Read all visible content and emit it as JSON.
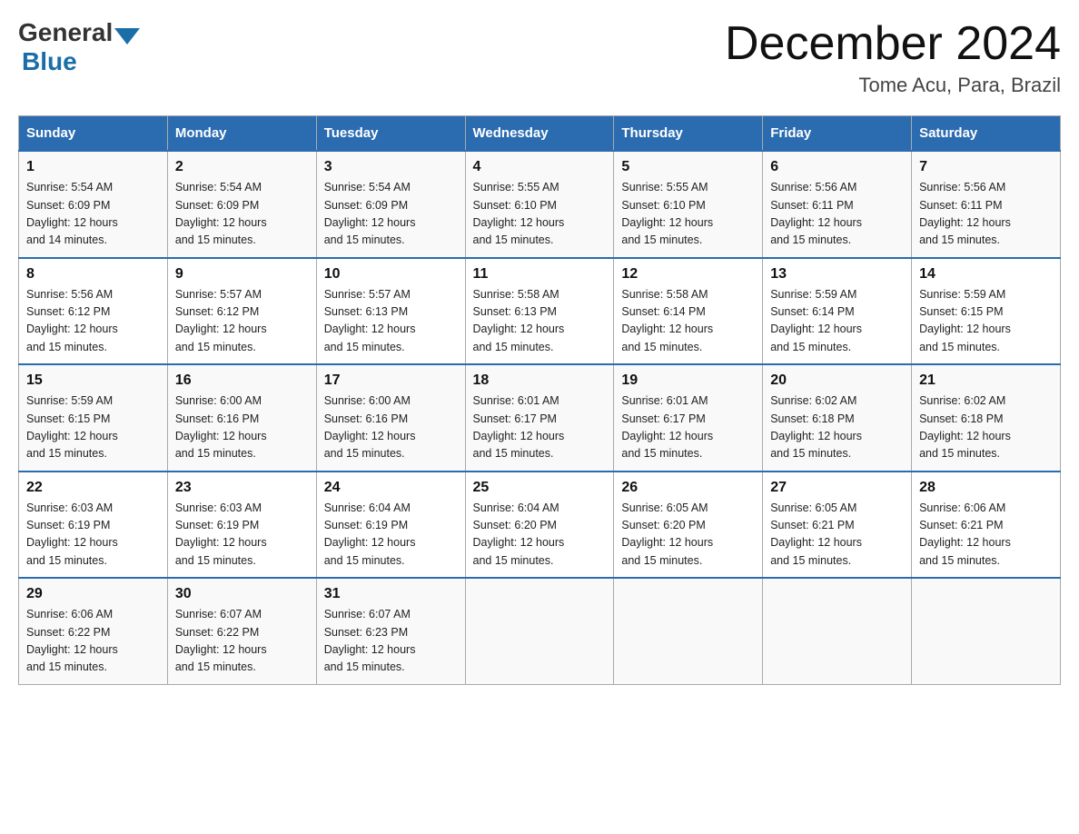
{
  "header": {
    "logo": {
      "general": "General",
      "blue": "Blue"
    },
    "title": "December 2024",
    "subtitle": "Tome Acu, Para, Brazil"
  },
  "columns": [
    "Sunday",
    "Monday",
    "Tuesday",
    "Wednesday",
    "Thursday",
    "Friday",
    "Saturday"
  ],
  "weeks": [
    [
      {
        "day": "1",
        "sunrise": "Sunrise: 5:54 AM",
        "sunset": "Sunset: 6:09 PM",
        "daylight": "Daylight: 12 hours",
        "daylight2": "and 14 minutes."
      },
      {
        "day": "2",
        "sunrise": "Sunrise: 5:54 AM",
        "sunset": "Sunset: 6:09 PM",
        "daylight": "Daylight: 12 hours",
        "daylight2": "and 15 minutes."
      },
      {
        "day": "3",
        "sunrise": "Sunrise: 5:54 AM",
        "sunset": "Sunset: 6:09 PM",
        "daylight": "Daylight: 12 hours",
        "daylight2": "and 15 minutes."
      },
      {
        "day": "4",
        "sunrise": "Sunrise: 5:55 AM",
        "sunset": "Sunset: 6:10 PM",
        "daylight": "Daylight: 12 hours",
        "daylight2": "and 15 minutes."
      },
      {
        "day": "5",
        "sunrise": "Sunrise: 5:55 AM",
        "sunset": "Sunset: 6:10 PM",
        "daylight": "Daylight: 12 hours",
        "daylight2": "and 15 minutes."
      },
      {
        "day": "6",
        "sunrise": "Sunrise: 5:56 AM",
        "sunset": "Sunset: 6:11 PM",
        "daylight": "Daylight: 12 hours",
        "daylight2": "and 15 minutes."
      },
      {
        "day": "7",
        "sunrise": "Sunrise: 5:56 AM",
        "sunset": "Sunset: 6:11 PM",
        "daylight": "Daylight: 12 hours",
        "daylight2": "and 15 minutes."
      }
    ],
    [
      {
        "day": "8",
        "sunrise": "Sunrise: 5:56 AM",
        "sunset": "Sunset: 6:12 PM",
        "daylight": "Daylight: 12 hours",
        "daylight2": "and 15 minutes."
      },
      {
        "day": "9",
        "sunrise": "Sunrise: 5:57 AM",
        "sunset": "Sunset: 6:12 PM",
        "daylight": "Daylight: 12 hours",
        "daylight2": "and 15 minutes."
      },
      {
        "day": "10",
        "sunrise": "Sunrise: 5:57 AM",
        "sunset": "Sunset: 6:13 PM",
        "daylight": "Daylight: 12 hours",
        "daylight2": "and 15 minutes."
      },
      {
        "day": "11",
        "sunrise": "Sunrise: 5:58 AM",
        "sunset": "Sunset: 6:13 PM",
        "daylight": "Daylight: 12 hours",
        "daylight2": "and 15 minutes."
      },
      {
        "day": "12",
        "sunrise": "Sunrise: 5:58 AM",
        "sunset": "Sunset: 6:14 PM",
        "daylight": "Daylight: 12 hours",
        "daylight2": "and 15 minutes."
      },
      {
        "day": "13",
        "sunrise": "Sunrise: 5:59 AM",
        "sunset": "Sunset: 6:14 PM",
        "daylight": "Daylight: 12 hours",
        "daylight2": "and 15 minutes."
      },
      {
        "day": "14",
        "sunrise": "Sunrise: 5:59 AM",
        "sunset": "Sunset: 6:15 PM",
        "daylight": "Daylight: 12 hours",
        "daylight2": "and 15 minutes."
      }
    ],
    [
      {
        "day": "15",
        "sunrise": "Sunrise: 5:59 AM",
        "sunset": "Sunset: 6:15 PM",
        "daylight": "Daylight: 12 hours",
        "daylight2": "and 15 minutes."
      },
      {
        "day": "16",
        "sunrise": "Sunrise: 6:00 AM",
        "sunset": "Sunset: 6:16 PM",
        "daylight": "Daylight: 12 hours",
        "daylight2": "and 15 minutes."
      },
      {
        "day": "17",
        "sunrise": "Sunrise: 6:00 AM",
        "sunset": "Sunset: 6:16 PM",
        "daylight": "Daylight: 12 hours",
        "daylight2": "and 15 minutes."
      },
      {
        "day": "18",
        "sunrise": "Sunrise: 6:01 AM",
        "sunset": "Sunset: 6:17 PM",
        "daylight": "Daylight: 12 hours",
        "daylight2": "and 15 minutes."
      },
      {
        "day": "19",
        "sunrise": "Sunrise: 6:01 AM",
        "sunset": "Sunset: 6:17 PM",
        "daylight": "Daylight: 12 hours",
        "daylight2": "and 15 minutes."
      },
      {
        "day": "20",
        "sunrise": "Sunrise: 6:02 AM",
        "sunset": "Sunset: 6:18 PM",
        "daylight": "Daylight: 12 hours",
        "daylight2": "and 15 minutes."
      },
      {
        "day": "21",
        "sunrise": "Sunrise: 6:02 AM",
        "sunset": "Sunset: 6:18 PM",
        "daylight": "Daylight: 12 hours",
        "daylight2": "and 15 minutes."
      }
    ],
    [
      {
        "day": "22",
        "sunrise": "Sunrise: 6:03 AM",
        "sunset": "Sunset: 6:19 PM",
        "daylight": "Daylight: 12 hours",
        "daylight2": "and 15 minutes."
      },
      {
        "day": "23",
        "sunrise": "Sunrise: 6:03 AM",
        "sunset": "Sunset: 6:19 PM",
        "daylight": "Daylight: 12 hours",
        "daylight2": "and 15 minutes."
      },
      {
        "day": "24",
        "sunrise": "Sunrise: 6:04 AM",
        "sunset": "Sunset: 6:19 PM",
        "daylight": "Daylight: 12 hours",
        "daylight2": "and 15 minutes."
      },
      {
        "day": "25",
        "sunrise": "Sunrise: 6:04 AM",
        "sunset": "Sunset: 6:20 PM",
        "daylight": "Daylight: 12 hours",
        "daylight2": "and 15 minutes."
      },
      {
        "day": "26",
        "sunrise": "Sunrise: 6:05 AM",
        "sunset": "Sunset: 6:20 PM",
        "daylight": "Daylight: 12 hours",
        "daylight2": "and 15 minutes."
      },
      {
        "day": "27",
        "sunrise": "Sunrise: 6:05 AM",
        "sunset": "Sunset: 6:21 PM",
        "daylight": "Daylight: 12 hours",
        "daylight2": "and 15 minutes."
      },
      {
        "day": "28",
        "sunrise": "Sunrise: 6:06 AM",
        "sunset": "Sunset: 6:21 PM",
        "daylight": "Daylight: 12 hours",
        "daylight2": "and 15 minutes."
      }
    ],
    [
      {
        "day": "29",
        "sunrise": "Sunrise: 6:06 AM",
        "sunset": "Sunset: 6:22 PM",
        "daylight": "Daylight: 12 hours",
        "daylight2": "and 15 minutes."
      },
      {
        "day": "30",
        "sunrise": "Sunrise: 6:07 AM",
        "sunset": "Sunset: 6:22 PM",
        "daylight": "Daylight: 12 hours",
        "daylight2": "and 15 minutes."
      },
      {
        "day": "31",
        "sunrise": "Sunrise: 6:07 AM",
        "sunset": "Sunset: 6:23 PM",
        "daylight": "Daylight: 12 hours",
        "daylight2": "and 15 minutes."
      },
      null,
      null,
      null,
      null
    ]
  ]
}
